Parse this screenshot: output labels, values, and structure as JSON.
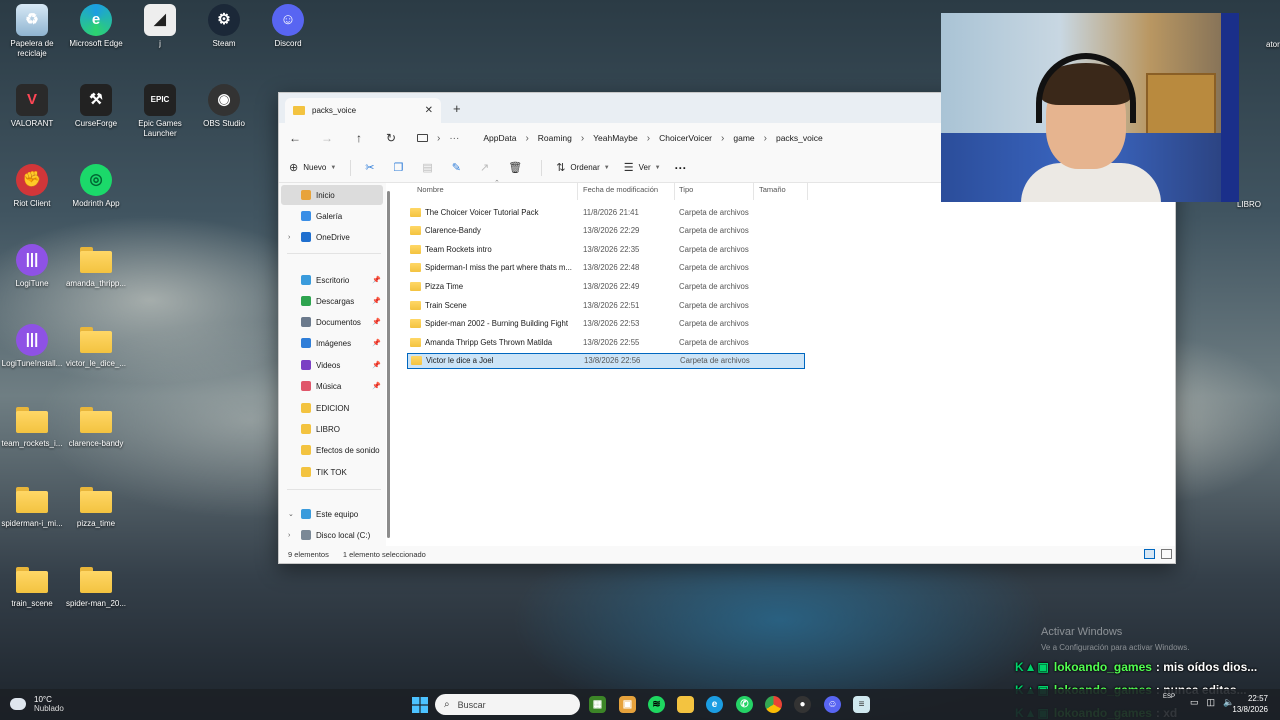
{
  "desktop": {
    "icons": [
      {
        "label": "Papelera de reciclaje",
        "icon": "recycle-bin-icon"
      },
      {
        "label": "Microsoft Edge",
        "icon": "edge-icon"
      },
      {
        "label": "j",
        "icon": "shortcut-icon"
      },
      {
        "label": "Steam",
        "icon": "steam-icon"
      },
      {
        "label": "Discord",
        "icon": "discord-icon"
      },
      {
        "label": "VALORANT",
        "icon": "valorant-icon"
      },
      {
        "label": "CurseForge",
        "icon": "curseforge-icon"
      },
      {
        "label": "Epic Games Launcher",
        "icon": "epic-games-icon"
      },
      {
        "label": "OBS Studio",
        "icon": "obs-icon"
      },
      {
        "label": "Riot Client",
        "icon": "riot-icon"
      },
      {
        "label": "Modrinth App",
        "icon": "modrinth-icon"
      },
      {
        "label": "LogiTune",
        "icon": "logitune-icon"
      },
      {
        "label": "amanda_thripp...",
        "icon": "folder-icon"
      },
      {
        "label": "LogiTuneInstall...",
        "icon": "logitune-icon"
      },
      {
        "label": "victor_le_dice_...",
        "icon": "folder-icon"
      },
      {
        "label": "team_rockets_i...",
        "icon": "folder-icon"
      },
      {
        "label": "clarence-bandy",
        "icon": "folder-icon"
      },
      {
        "label": "spiderman-i_mi...",
        "icon": "folder-icon"
      },
      {
        "label": "pizza_time",
        "icon": "folder-icon"
      },
      {
        "label": "train_scene",
        "icon": "folder-icon"
      },
      {
        "label": "spider-man_20...",
        "icon": "folder-icon"
      }
    ],
    "right_edge_labels": [
      "ator",
      "LIBRO"
    ]
  },
  "explorer": {
    "tab_title": "packs_voice",
    "breadcrumb": [
      "AppData",
      "Roaming",
      "YeahMaybe",
      "ChoicerVoicer",
      "game",
      "packs_voice"
    ],
    "toolbar": {
      "new_label": "Nuevo",
      "sort_label": "Ordenar",
      "view_label": "Ver",
      "more_label": "···"
    },
    "sidebar": [
      {
        "label": "Inicio",
        "color": "#e8a33a",
        "selected": true
      },
      {
        "label": "Galería",
        "color": "#3a8ee6"
      },
      {
        "label": "OneDrive",
        "color": "#1f6fcf",
        "expandable": true
      },
      {
        "label": "Escritorio",
        "color": "#3a9bdc",
        "pinned": true
      },
      {
        "label": "Descargas",
        "color": "#2ea44f",
        "pinned": true
      },
      {
        "label": "Documentos",
        "color": "#6b7a8c",
        "pinned": true
      },
      {
        "label": "Imágenes",
        "color": "#2f7ed8",
        "pinned": true
      },
      {
        "label": "Videos",
        "color": "#7b3fc4",
        "pinned": true
      },
      {
        "label": "Música",
        "color": "#e0566a",
        "pinned": true
      },
      {
        "label": "EDICION",
        "color": "#f3c340"
      },
      {
        "label": "LIBRO",
        "color": "#f3c340"
      },
      {
        "label": "Efectos de sonido",
        "color": "#f3c340"
      },
      {
        "label": "TIK TOK",
        "color": "#f3c340"
      },
      {
        "label": "Este equipo",
        "color": "#3a9bdc",
        "expanded": true
      },
      {
        "label": "Disco local (C:)",
        "color": "#7a8896",
        "expandable": true
      }
    ],
    "columns": [
      "Nombre",
      "Fecha de modificación",
      "Tipo",
      "Tamaño"
    ],
    "files": [
      {
        "name": "The Choicer Voicer Tutorial Pack",
        "date": "11/8/2026 21:41",
        "type": "Carpeta de archivos"
      },
      {
        "name": "Clarence-Bandy",
        "date": "13/8/2026 22:29",
        "type": "Carpeta de archivos"
      },
      {
        "name": "Team Rockets intro",
        "date": "13/8/2026 22:35",
        "type": "Carpeta de archivos"
      },
      {
        "name": "Spiderman-I miss the part where thats m...",
        "date": "13/8/2026 22:48",
        "type": "Carpeta de archivos"
      },
      {
        "name": "Pizza Time",
        "date": "13/8/2026 22:49",
        "type": "Carpeta de archivos"
      },
      {
        "name": "Train Scene",
        "date": "13/8/2026 22:51",
        "type": "Carpeta de archivos"
      },
      {
        "name": "Spider-man 2002 - Burning Building Fight",
        "date": "13/8/2026 22:53",
        "type": "Carpeta de archivos"
      },
      {
        "name": "Amanda Thripp Gets Thrown Matilda",
        "date": "13/8/2026 22:55",
        "type": "Carpeta de archivos"
      },
      {
        "name": "Victor le dice a Joel",
        "date": "13/8/2026 22:56",
        "type": "Carpeta de archivos",
        "selected": true
      }
    ],
    "status": {
      "count": "9 elementos",
      "selection": "1 elemento seleccionado"
    }
  },
  "overlay": {
    "activate_title": "Activar Windows",
    "activate_sub": "Ve a Configuración para activar Windows.",
    "chat": [
      {
        "user": "lokoando_games",
        "message": ": mis oídos dios..."
      },
      {
        "user": "lokoando_games",
        "message": ": nunca editas..."
      },
      {
        "user": "lokoando_games",
        "message": ": xd"
      }
    ]
  },
  "taskbar": {
    "temperature": "10°C",
    "weather": "Nublado",
    "search_placeholder": "Buscar",
    "lang": "ESP",
    "time": "22:57",
    "date": "13/8/2026"
  }
}
